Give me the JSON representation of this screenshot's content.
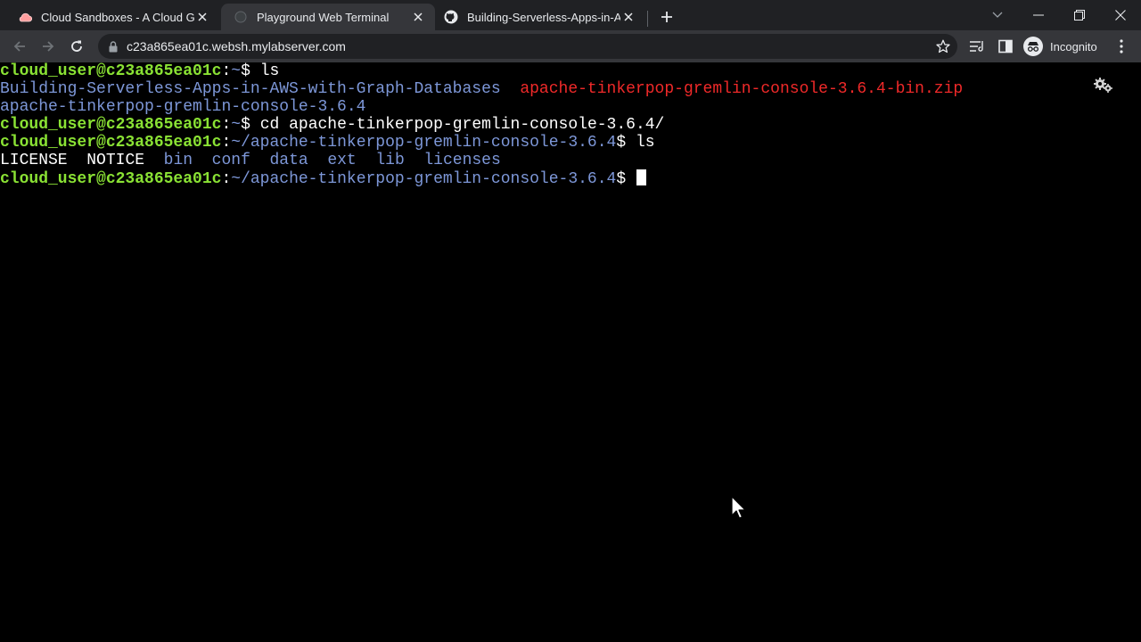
{
  "browser": {
    "tabs": [
      {
        "title": "Cloud Sandboxes - A Cloud Guru",
        "icon": "cloud-icon",
        "active": false
      },
      {
        "title": "Playground Web Terminal",
        "icon": "globe-icon",
        "active": true
      },
      {
        "title": "Building-Serverless-Apps-in-AWS",
        "icon": "github-icon",
        "active": false
      }
    ],
    "url": "c23a865ea01c.websh.mylabserver.com",
    "profile_label": "Incognito"
  },
  "terminal": {
    "lines": [
      {
        "prompt_user": "cloud_user@c23a865ea01c",
        "prompt_sep": ":",
        "prompt_path": "~",
        "prompt_end": "$ ",
        "command": "ls"
      },
      {
        "item1": "Building-Serverless-Apps-in-AWS-with-Graph-Databases",
        "item2": "apache-tinkerpop-gremlin-console-3.6.4-bin.zip"
      },
      {
        "item1": "apache-tinkerpop-gremlin-console-3.6.4"
      },
      {
        "prompt_user": "cloud_user@c23a865ea01c",
        "prompt_sep": ":",
        "prompt_path": "~",
        "prompt_end": "$ ",
        "command": "cd apache-tinkerpop-gremlin-console-3.6.4/"
      },
      {
        "prompt_user": "cloud_user@c23a865ea01c",
        "prompt_sep": ":",
        "prompt_path": "~/apache-tinkerpop-gremlin-console-3.6.4",
        "prompt_end": "$ ",
        "command": "ls"
      },
      {
        "files": [
          "LICENSE",
          "NOTICE"
        ],
        "dirs": [
          "bin",
          "conf",
          "data",
          "ext",
          "lib",
          "licenses"
        ]
      },
      {
        "prompt_user": "cloud_user@c23a865ea01c",
        "prompt_sep": ":",
        "prompt_path": "~/apache-tinkerpop-gremlin-console-3.6.4",
        "prompt_end": "$ ",
        "command": ""
      }
    ]
  },
  "colors": {
    "prompt_user": "#8ae234",
    "directory": "#7d97d8",
    "archive": "#ef2929",
    "background": "#000000",
    "tabstrip": "#202124",
    "toolbar": "#35363a"
  }
}
